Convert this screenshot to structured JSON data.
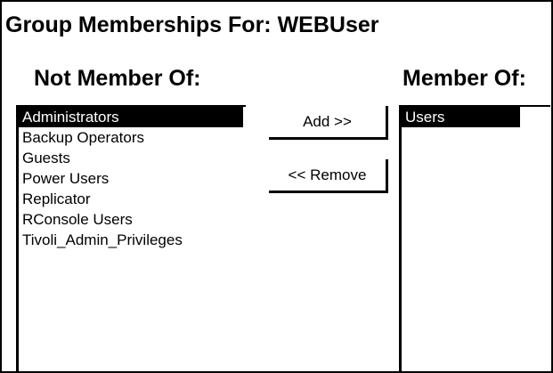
{
  "dialog": {
    "title": "Group Memberships For: WEBUser"
  },
  "not_member": {
    "heading": "Not Member Of:",
    "items": [
      "Administrators",
      "Backup Operators",
      "Guests",
      "Power Users",
      "Replicator",
      "RConsole Users",
      "Tivoli_Admin_Privileges"
    ],
    "selected": "Administrators"
  },
  "member": {
    "heading": "Member Of:",
    "items": [
      "Users"
    ],
    "selected": "Users"
  },
  "buttons": {
    "add_label": "Add >>",
    "remove_label": "<< Remove"
  },
  "colors": {
    "selection_background": "#000000",
    "selection_text": "#ffffff",
    "background": "#ffffff"
  }
}
